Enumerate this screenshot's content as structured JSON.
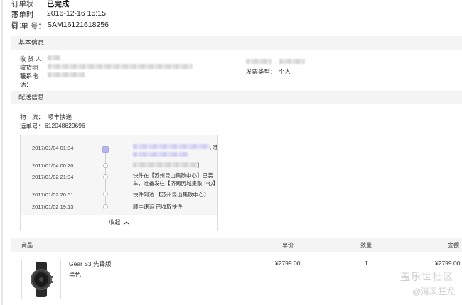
{
  "summary": {
    "status_label": "订单状态：",
    "status_value": "已完成",
    "time_label": "下单时间：",
    "time_value": "2016-12-16 15:15",
    "number_label": "订 单 号：",
    "number_value": "SAM16121618256"
  },
  "basic_info": {
    "title": "基本信息",
    "receiver_label": "收 货 人：",
    "address_label": "收货地址：",
    "phone_label": "联系电话：",
    "invoice_label": "发票类型：",
    "invoice_value": "个人"
  },
  "shipping": {
    "title": "配送信息",
    "carrier_label": "物　流：",
    "carrier_value": "顺丰快递",
    "waybill_label": "运单号：",
    "waybill_value": "612048629696",
    "events": [
      {
        "date": "2017/01/04 01:34",
        "desc": "",
        "tail": ", 准"
      },
      {
        "date": "2017/01/04 00:20",
        "desc": "",
        "tail": "】"
      },
      {
        "date": "2017/01/02 21:34",
        "desc": "快件在【苏州昆山集散中心】已装车，准备发往【济南历城集散中心】",
        "tail": ""
      },
      {
        "date": "2017/01/02 20:51",
        "desc": "快件到达 【苏州昆山集散中心】",
        "tail": ""
      },
      {
        "date": "2017/01/02 19:13",
        "desc": "顺丰速运 已收取快件",
        "tail": ""
      }
    ],
    "collapse_label": "收起",
    "collapse_icon": "chevron-up-icon"
  },
  "products": {
    "headers": {
      "item": "商品",
      "price": "单价",
      "qty": "数量",
      "amount": "金额"
    },
    "rows": [
      {
        "name": "Gear S3 先锋版",
        "color": "黑色",
        "price": "¥2799.00",
        "qty": "1",
        "amount": "¥2799.00"
      }
    ]
  },
  "watermark": {
    "line1": "盖乐世社区",
    "line2": "@清风狂龙"
  }
}
